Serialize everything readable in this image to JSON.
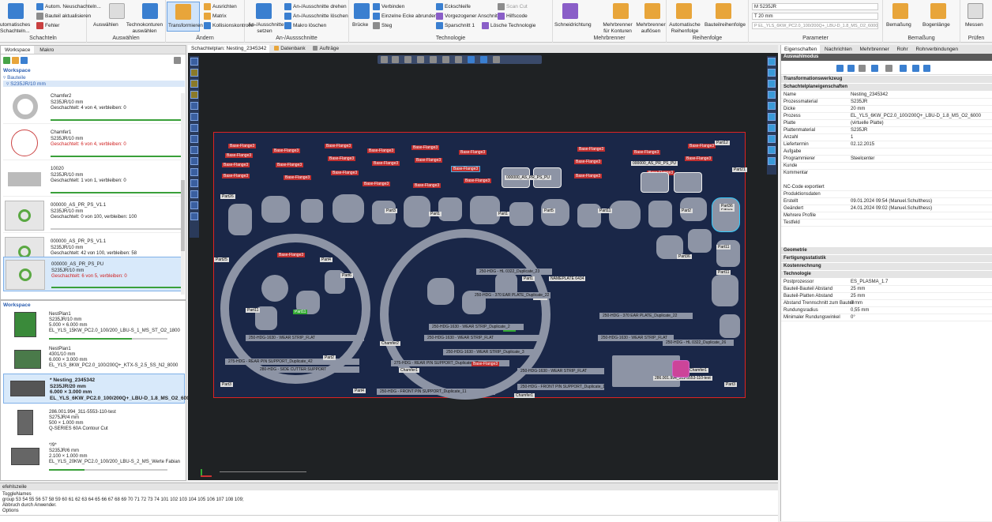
{
  "ribbon": {
    "groups": [
      {
        "title": "Schachteln",
        "items": [
          "Autom. Neuschachteln...",
          "Bauteil aktualisieren",
          "Fehler",
          "utomatisches Schachteln..."
        ]
      },
      {
        "title": "Auswählen",
        "items": [
          "Auswählen",
          "Technokonturen auswählen"
        ]
      },
      {
        "title": "Ändern",
        "items": [
          "Transformieren",
          "Ausrichten",
          "Matrix",
          "Kollisionskontrolle"
        ]
      },
      {
        "title": "An-/Aussschnitte",
        "items": [
          "An-/Ausschnitte setzen",
          "An-/Ausschnitte drehen",
          "An-/Ausschnitte löschen",
          "Makro löschen"
        ]
      },
      {
        "title": "Technologie",
        "items": [
          "Brücke",
          "Verbinden",
          "Einzelne Ecke abrunden",
          "Steg",
          "Eckschleife",
          "Vorgezogener Anschnitt",
          "Sparschnitt 1",
          "Scan Cut",
          "Hilfscode",
          "Lösche Technologie"
        ]
      },
      {
        "title": "Mehrbrenner",
        "items": [
          "Schneidrichtung",
          "Mehrbrenner für Konturen",
          "Mehrbrenner auflösen"
        ]
      },
      {
        "title": "Reihenfolge",
        "items": [
          "Automatische Reihenfolge",
          "Bauteilreihenfolge"
        ]
      },
      {
        "title": "Parameter",
        "items": [
          "M S235JR",
          "T 20 mm",
          "P EL_YLS_6KW_PC2.0_100/200Q+_LBU-D_1.8_MS_O2_6000"
        ]
      },
      {
        "title": "Bemaßung",
        "items": [
          "Bemaßung",
          "Bogenlänge"
        ]
      },
      {
        "title": "Prüfen",
        "items": [
          "Messen"
        ]
      }
    ]
  },
  "left_panel": {
    "tabs": [
      "Workspace",
      "Makro"
    ],
    "tree_root": "Workspace",
    "tree_sub": "Bauteile",
    "tree_material": "S235JR/10 mm",
    "parts": [
      {
        "name": "Chamfer2",
        "material": "S235JR/10 mm",
        "status": "Geschachtelt: 4 von 4, verbleiben: 0",
        "status_color": "#333333",
        "bar": "#3aa03a"
      },
      {
        "name": "Chamfer1",
        "material": "S235JR/10 mm",
        "status": "Geschachtelt: 6 von 4, verbleiben: 0",
        "status_color": "#d02020",
        "bar": "#3aa03a"
      },
      {
        "name": "10020",
        "material": "S235JR/10 mm",
        "status": "Geschachtelt: 1 von 1, verbleiben: 0",
        "status_color": "#333333",
        "bar": "#3aa03a"
      },
      {
        "name": "000000_AS_PR_PS_V1.1",
        "material": "S235JR/10 mm",
        "status": "Geschachtelt: 0 von 100, verbleiben: 100",
        "status_color": "#333333",
        "bar": "#cccccc"
      },
      {
        "name": "000000_AS_PR_PS_V1.1",
        "material": "S235JR/10 mm",
        "status": "Geschachtelt: 42 von 100, verbleiben: 58",
        "status_color": "#333333",
        "bar": "#3aa03a"
      },
      {
        "name": "000000_AS_PR_PS_PU",
        "material": "S235JR/10 mm",
        "status": "Geschachtelt: 6 von 5, verbleiben: 0",
        "status_color": "#d02020",
        "bar": "#3aa03a"
      }
    ],
    "workspace_label": "Workspace",
    "nestings": [
      {
        "line1": "NestPlan1",
        "line2": "S235JR/10 mm",
        "line3": "5.000 × 6.000 mm",
        "line4": "EL_YLS_15KW_PC2.0_100/200_LBU-S_1_MS_ST_O2_1800",
        "bold": false
      },
      {
        "line1": "NestPlan1",
        "line2": "4301/10 mm",
        "line3": "6.000 × 3.000 mm",
        "line4": "EL_YLS_8KW_PC2.0_100/200Q+_KTX-S_2.5_SS_N2_8000",
        "bold": false
      },
      {
        "line1": "* Nesting_2345342",
        "line2": "S235JR/20 mm",
        "line3": "6.000 × 3.000 mm",
        "line4": "EL_YLS_6KW_PC2.0_100/200Q+_LBU-D_1.8_MS_O2_6000",
        "bold": true
      },
      {
        "line1": "286.001.994_311-5553-110-test",
        "line2": "S275JR/4 mm",
        "line3": "500 × 1.000 mm",
        "line4": "Q-SERIES 60A Contour Cut",
        "bold": false
      },
      {
        "line1": "*/9*",
        "line2": "S235JR/6 mm",
        "line3": "2.100 × 1.000 mm",
        "line4": "EL_YLS_20KW_PC2.0_100/200_LBU-S_2_MS_Werte Fabian",
        "bold": false
      }
    ]
  },
  "canvas": {
    "tabs": [
      "Schachtelplan: Nesting_2345342",
      "Datenbank",
      "Aufträge"
    ],
    "labels": {
      "base_flange": "Base-Flange3",
      "part1": "Part1",
      "part2": "Part2",
      "part3": "Part3",
      "part4": "Part4",
      "part5": "Part5",
      "part6": "Part6",
      "part11": "Part11",
      "part12": "Part12",
      "part21": "Part21",
      "part25": "Part25",
      "part26": "Part26",
      "part31": "Part31",
      "part36": "Part36",
      "chamfer1": "Chamfer1",
      "chamfer2": "Chamfer2",
      "as_pr_ps_pu": "000000_AS_PR_PS_PU",
      "nameplate": "NAMEPLATE 6434",
      "strip1": "250-HDG-1630 - WEAR STRIP_FLAT",
      "strip2": "250-HDG-1630 - WEAR STRIP_FLAT",
      "strip3": "250-HDG-1630 - WEAR STRIP_FLAT",
      "strip4": "250-HDG-1630 - WEAR STRIP_Duplicate_2",
      "strip5": "250-HDG-1630 - WEAR STRIP_Duplicate_3",
      "rear_pin": "275-HDG - REAR PIN SUPPORT_Duplicate_42",
      "side_cutter": "280-HDG - SIDE CUTTER SUPPORT",
      "front_pin": "250-HDG - FRONT PIN SUPPORT_Duplicate_11",
      "front_pin2": "250-HDG - FRONT PIN SUPPORT_Duplicate_17",
      "ear_plate": "250-HDG - 370 EAR PLATE_Duplicate_22",
      "ear_plate2": "250-HDG - 370 EAR PLATE_Duplicate_22",
      "hl_duplicate": "250-HDG - HL 0322_Duplicate_23",
      "hl_duplicate2": "250-HDG - HL 0322_Duplicate_26",
      "sw_label": "286.001.994_311-5553-110-test"
    }
  },
  "properties": {
    "tabs": [
      "Eigenschaften",
      "Nachrichten",
      "Mehrbrenner",
      "Rohr",
      "Rohrverbindungen"
    ],
    "mode_label": "Auswahlmodus",
    "section1": "Transformationswerkzeug",
    "section2": "Schachtelplaneigenschaften",
    "rows": [
      {
        "k": "Name",
        "v": "Nesting_2345342"
      },
      {
        "k": "Prozessmaterial",
        "v": "S235JR"
      },
      {
        "k": "Dicke",
        "v": "20 mm"
      },
      {
        "k": "Prozess",
        "v": "EL_YLS_6KW_PC2.0_100/200Q+_LBU-D_1.8_MS_O2_6000"
      },
      {
        "k": "Platte",
        "v": "(virtuelle Platte)"
      },
      {
        "k": "Plattenmaterial",
        "v": "S235JR"
      },
      {
        "k": "Anzahl",
        "v": "1"
      },
      {
        "k": "Liefertermin",
        "v": "02.12.2015"
      },
      {
        "k": "Aufgabe",
        "v": ""
      },
      {
        "k": "Programmierer",
        "v": "Steelcenter"
      },
      {
        "k": "Kunde",
        "v": ""
      },
      {
        "k": "Kommentar",
        "v": ""
      }
    ],
    "rows2": [
      {
        "k": "NC-Code exportiert",
        "v": ""
      },
      {
        "k": "Produktionsdaten",
        "v": ""
      },
      {
        "k": "Erstellt",
        "v": "09.01.2024 09:54 (Manuel.Schulthess)"
      },
      {
        "k": "Geändert",
        "v": "24.01.2024 09:02 (Manuel.Schulthess)"
      },
      {
        "k": "Mehrere Profile",
        "v": ""
      },
      {
        "k": "Testfeld",
        "v": ""
      }
    ],
    "sections": [
      "Geometrie",
      "Fertigungsstatistik",
      "Kostenrechnung",
      "Technologie"
    ],
    "tech_rows": [
      {
        "k": "Postprozessor",
        "v": "ES_PLASMA_1.7"
      },
      {
        "k": "Bauteil-Bauteil Abstand",
        "v": "25 mm"
      },
      {
        "k": "Bauteil-Platten Abstand",
        "v": "25 mm"
      },
      {
        "k": "Abstand Trennschnitt zum Bauteil",
        "v": "0 mm"
      },
      {
        "k": "Rundungsradius",
        "v": "0,55 mm"
      },
      {
        "k": "Minimaler Rundungswinkel",
        "v": "0°"
      }
    ]
  },
  "command": {
    "tab": "efehlszeile",
    "lines": [
      "ToggleNames",
      "group 53 54 55 56 57 58 59 60 61 62 63 64 65 66 67 68 69 70 71 72 73 74 101 102 103 104 105 106 107 108 109;",
      "Abbruch durch Anwender.",
      "Options"
    ]
  }
}
